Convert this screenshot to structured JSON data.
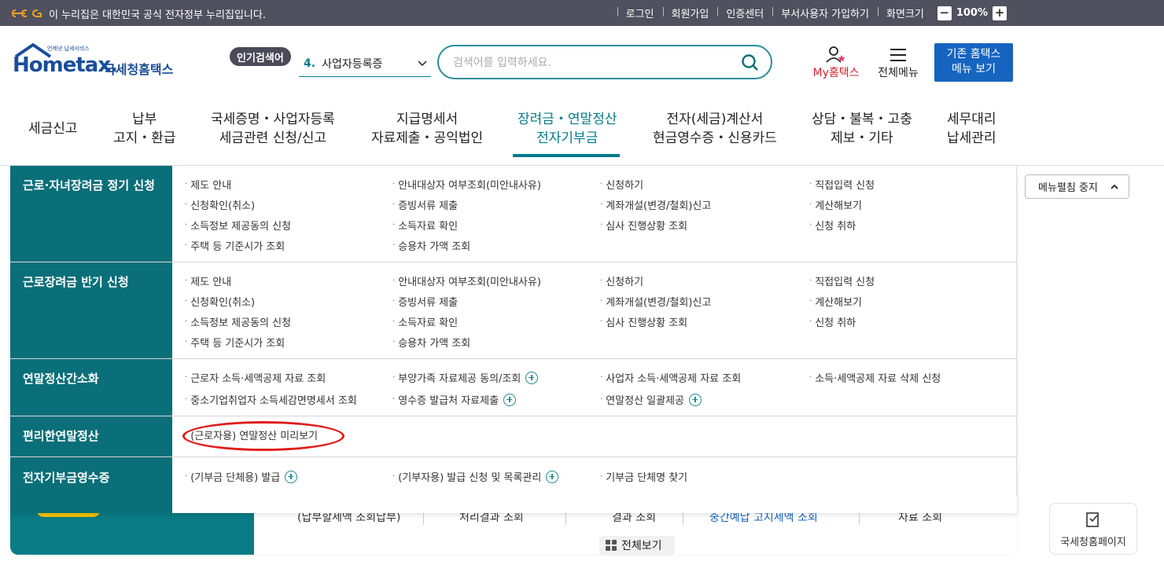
{
  "gov_banner": {
    "text": "이 누리집은 대한민국 공식 전자정부 누리집입니다.",
    "links": [
      "로그인",
      "회원가입",
      "인증센터",
      "부서사용자 가입하기",
      "화면크기"
    ],
    "zoom_minus": "−",
    "zoom_value": "100%",
    "zoom_plus": "+",
    "logo_icon": "egov-logo-icon"
  },
  "header": {
    "logo_sub": "언제냇 납세서비스",
    "logo_home": "Hometax.",
    "logo_kr": "국세청홈택스",
    "popular_badge": "인기검색어",
    "popular_rank": "4.",
    "popular_term": "사업자등록증",
    "search_placeholder": "검색어를 입력하세요.",
    "my_hometax": "My홈택스",
    "all_menu": "전체메뉴",
    "old_menu_line1": "기존 홈택스",
    "old_menu_line2": "메뉴 보기"
  },
  "gnb": [
    {
      "line1": "세금신고",
      "line2": ""
    },
    {
      "line1": "납부",
      "line2": "고지・환급"
    },
    {
      "line1": "국세증명・사업자등록",
      "line2": "세금관련 신청/신고"
    },
    {
      "line1": "지급명세서",
      "line2": "자료제출・공익법인"
    },
    {
      "line1": "장려금・연말정산",
      "line2": "전자기부금"
    },
    {
      "line1": "전자(세금)계산서",
      "line2": "현금영수증・신용카드"
    },
    {
      "line1": "상담・불복・고충",
      "line2": "제보・기타"
    },
    {
      "line1": "세무대리",
      "line2": "납세관리"
    }
  ],
  "mega_menu": {
    "stop_button": "메뉴펼침 중지",
    "sections": [
      {
        "title": "근로·자녀장려금 정기 신청",
        "items": [
          [
            "제도 안내",
            "안내대상자 여부조회(미안내사유)",
            "신청하기",
            "직접입력 신청"
          ],
          [
            "신청확인(취소)",
            "증빙서류 제출",
            "계좌개설(변경/철회)신고",
            "계산해보기"
          ],
          [
            "소득정보 제공동의 신청",
            "소득자료 확인",
            "심사 진행상황 조회",
            "신청 취하"
          ],
          [
            "주택 등 기준시가 조회",
            "승용차 가액 조회",
            "",
            ""
          ]
        ]
      },
      {
        "title": "근로장려금 반기 신청",
        "items": [
          [
            "제도 안내",
            "안내대상자 여부조회(미안내사유)",
            "신청하기",
            "직접입력 신청"
          ],
          [
            "신청확인(취소)",
            "증빙서류 제출",
            "계좌개설(변경/철회)신고",
            "계산해보기"
          ],
          [
            "소득정보 제공동의 신청",
            "소득자료 확인",
            "심사 진행상황 조회",
            "신청 취하"
          ],
          [
            "주택 등 기준시가 조회",
            "승용차 가액 조회",
            "",
            ""
          ]
        ]
      },
      {
        "title": "연말정산간소화",
        "items": [
          [
            "근로자 소득·세액공제 자료 조회",
            "부양가족 자료제공 동의/조회",
            "사업자 소득·세액공제 자료 조회",
            "소득·세액공제 자료 삭제 신청"
          ],
          [
            "중소기업취업자 소득세감면명세서 조회",
            "영수증 발급처 자료제출",
            "연말정산 일괄제공",
            ""
          ]
        ]
      },
      {
        "title": "편리한연말정산",
        "items": [
          [
            "(근로자용) 연말정산 미리보기",
            "",
            "",
            ""
          ]
        ]
      },
      {
        "title": "전자기부금영수증",
        "items": [
          [
            "(기부금 단체용) 발급",
            "(기부자용) 발급 신청 및 목록관리",
            "기부금 단체명 찾기",
            ""
          ]
        ]
      }
    ]
  },
  "background": {
    "row_items": [
      "(납부할세액 조회납부)",
      "처리결과 조회",
      "결과 조회",
      "중간예납 고지세액 조회",
      "자료 조회"
    ],
    "all_view": "전체보기",
    "hometax_page": "국세청홈페이지"
  },
  "colors": {
    "gov_bar": "#50505e",
    "teal": "#0a6f79",
    "accent": "#007b8a",
    "my_red": "#d3212f",
    "blue_button": "#1565c0",
    "highlight": "#e21b1b"
  }
}
